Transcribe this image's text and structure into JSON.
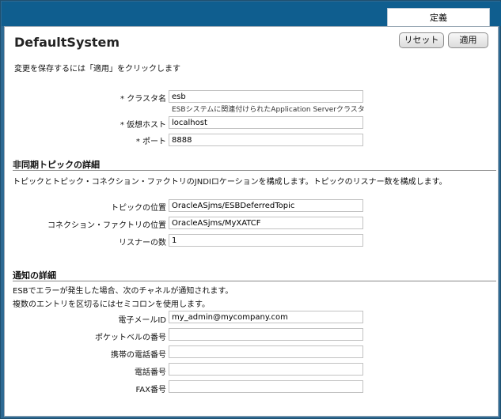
{
  "tab": {
    "label": "定義"
  },
  "page": {
    "title": "DefaultSystem",
    "instruction": "変更を保存するには「適用」をクリックします"
  },
  "buttons": {
    "reset": "リセット",
    "apply": "適用"
  },
  "general": {
    "cluster_label": "* クラスタ名",
    "cluster_value": "esb",
    "cluster_help": "ESBシステムに関連付けられたApplication Serverクラスタ",
    "virtual_host_label": "* 仮想ホスト",
    "virtual_host_value": "localhost",
    "port_label": "* ポート",
    "port_value": "8888"
  },
  "async": {
    "title": "非同期トピックの詳細",
    "desc": "トピックとトピック・コネクション・ファクトリのJNDIロケーションを構成します。トピックのリスナー数を構成します。",
    "topic_label": "トピックの位置",
    "topic_value": "OracleASjms/ESBDeferredTopic",
    "factory_label": "コネクション・ファクトリの位置",
    "factory_value": "OracleASjms/MyXATCF",
    "listeners_label": "リスナーの数",
    "listeners_value": "1"
  },
  "notify": {
    "title": "通知の詳細",
    "desc1": "ESBでエラーが発生した場合、次のチャネルが通知されます。",
    "desc2": "複数のエントリを区切るにはセミコロンを使用します。",
    "email_label": "電子メールID",
    "email_value": "my_admin@mycompany.com",
    "pager_label": "ポケットベルの番号",
    "pager_value": "",
    "mobile_label": "携帯の電話番号",
    "mobile_value": "",
    "phone_label": "電話番号",
    "phone_value": "",
    "fax_label": "FAX番号",
    "fax_value": ""
  }
}
